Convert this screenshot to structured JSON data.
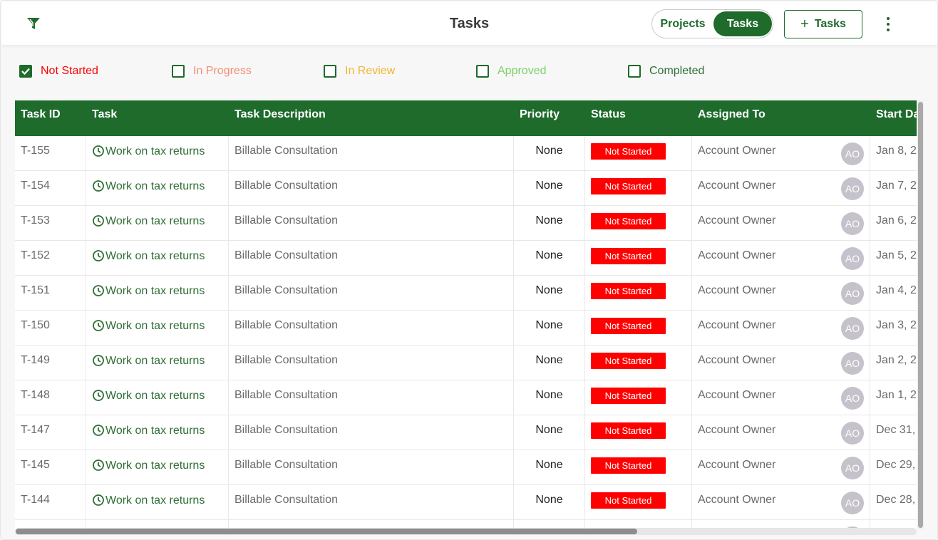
{
  "header": {
    "title": "Tasks",
    "toggle": {
      "projects_label": "Projects",
      "tasks_label": "Tasks",
      "active": "Tasks"
    },
    "add_button_label": "Tasks",
    "icons": {
      "filter": "filter-icon",
      "more": "more-vertical-icon",
      "add": "plus-icon"
    }
  },
  "status_filters": [
    {
      "label": "Not Started",
      "checked": true,
      "color": "#ff0000"
    },
    {
      "label": "In Progress",
      "checked": false,
      "color": "#f28f74"
    },
    {
      "label": "In Review",
      "checked": false,
      "color": "#f2b632"
    },
    {
      "label": "Approved",
      "checked": false,
      "color": "#7bd163"
    },
    {
      "label": "Completed",
      "checked": false,
      "color": "#2f6e35"
    }
  ],
  "table": {
    "columns": [
      "Task ID",
      "Task",
      "Task Description",
      "Priority",
      "Status",
      "Assigned To",
      "Start Da"
    ],
    "rows": [
      {
        "id": "T-155",
        "task": "Work on tax returns",
        "description": "Billable Consultation",
        "priority": "None",
        "status": "Not Started",
        "assigned": "Account Owner",
        "avatar": "AO",
        "start": "Jan 8, 2"
      },
      {
        "id": "T-154",
        "task": "Work on tax returns",
        "description": "Billable Consultation",
        "priority": "None",
        "status": "Not Started",
        "assigned": "Account Owner",
        "avatar": "AO",
        "start": "Jan 7, 2"
      },
      {
        "id": "T-153",
        "task": "Work on tax returns",
        "description": "Billable Consultation",
        "priority": "None",
        "status": "Not Started",
        "assigned": "Account Owner",
        "avatar": "AO",
        "start": "Jan 6, 2"
      },
      {
        "id": "T-152",
        "task": "Work on tax returns",
        "description": "Billable Consultation",
        "priority": "None",
        "status": "Not Started",
        "assigned": "Account Owner",
        "avatar": "AO",
        "start": "Jan 5, 2"
      },
      {
        "id": "T-151",
        "task": "Work on tax returns",
        "description": "Billable Consultation",
        "priority": "None",
        "status": "Not Started",
        "assigned": "Account Owner",
        "avatar": "AO",
        "start": "Jan 4, 2"
      },
      {
        "id": "T-150",
        "task": "Work on tax returns",
        "description": "Billable Consultation",
        "priority": "None",
        "status": "Not Started",
        "assigned": "Account Owner",
        "avatar": "AO",
        "start": "Jan 3, 2"
      },
      {
        "id": "T-149",
        "task": "Work on tax returns",
        "description": "Billable Consultation",
        "priority": "None",
        "status": "Not Started",
        "assigned": "Account Owner",
        "avatar": "AO",
        "start": "Jan 2, 2"
      },
      {
        "id": "T-148",
        "task": "Work on tax returns",
        "description": "Billable Consultation",
        "priority": "None",
        "status": "Not Started",
        "assigned": "Account Owner",
        "avatar": "AO",
        "start": "Jan 1, 2"
      },
      {
        "id": "T-147",
        "task": "Work on tax returns",
        "description": "Billable Consultation",
        "priority": "None",
        "status": "Not Started",
        "assigned": "Account Owner",
        "avatar": "AO",
        "start": "Dec 31,"
      },
      {
        "id": "T-145",
        "task": "Work on tax returns",
        "description": "Billable Consultation",
        "priority": "None",
        "status": "Not Started",
        "assigned": "Account Owner",
        "avatar": "AO",
        "start": "Dec 29,"
      },
      {
        "id": "T-144",
        "task": "Work on tax returns",
        "description": "Billable Consultation",
        "priority": "None",
        "status": "Not Started",
        "assigned": "Account Owner",
        "avatar": "AO",
        "start": "Dec 28,"
      },
      {
        "id": "",
        "task": "",
        "description": "",
        "priority": "",
        "status": "",
        "assigned": "",
        "avatar": "",
        "start": ""
      }
    ]
  },
  "colors": {
    "brand_green": "#1e6b2c",
    "status_red": "#ff0000",
    "avatar_bg": "#c6c2cb"
  }
}
